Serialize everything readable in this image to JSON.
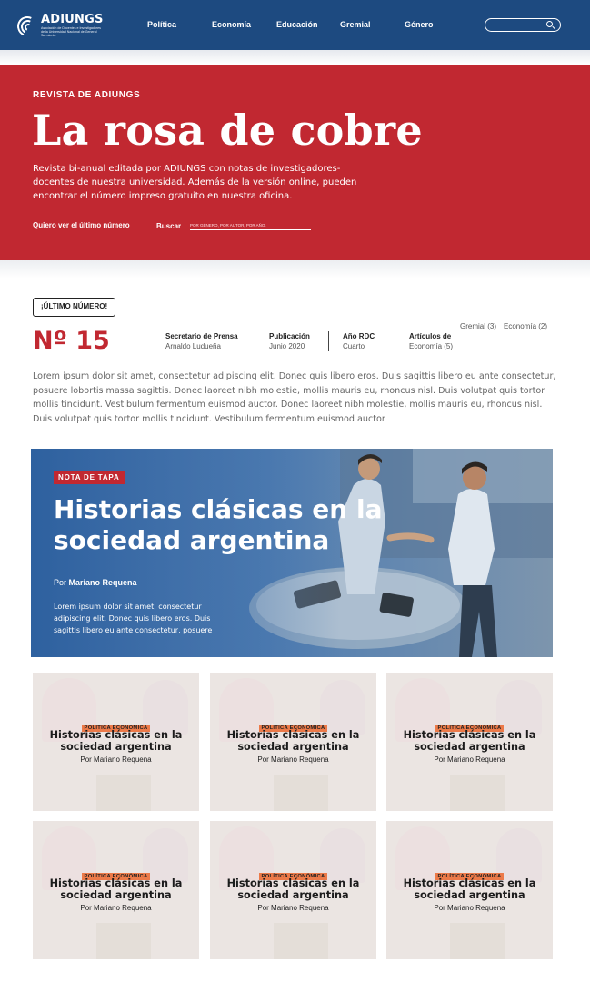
{
  "header": {
    "logo_name": "ADIUNGS",
    "logo_subtitle": "Asociación de Docentes e Investigadores de la Universidad Nacional de General Sarmiento",
    "nav": [
      "Política",
      "Economía",
      "Educación",
      "Gremial",
      "Género"
    ],
    "search_icon": "search-icon",
    "brand_color": "#1d4a80"
  },
  "hero": {
    "kicker": "REVISTA DE ADIUNGS",
    "title": "La rosa de cobre",
    "description": "Revista bi-anual editada por ADIUNGS con notas de investigadores-docentes de nuestra universidad. Además de la versión online, pueden encontrar el número impreso gratuito en nuestra oficina.",
    "latest_link": "Quiero ver el último número",
    "search_label": "Buscar",
    "search_placeholder": "POR GÉNERO, POR AUTOR, POR AÑO.",
    "color": "#c12831"
  },
  "issue": {
    "badge": "¡ÚLTIMO NÚMERO!",
    "number": "Nº 15",
    "meta": [
      {
        "key": "Secretario de Prensa",
        "value": "Arnaldo Ludueña"
      },
      {
        "key": "Publicación",
        "value": "Junio 2020"
      },
      {
        "key": "Año RDC",
        "value": "Cuarto"
      },
      {
        "key": "Artículos de",
        "value": "Economía (5)"
      }
    ],
    "tags": [
      "Gremial (3)",
      "Economía (2)"
    ],
    "body": "Lorem ipsum dolor sit amet, consectetur adipiscing elit. Donec quis libero eros. Duis sagittis libero eu ante consectetur, posuere lobortis massa sagittis. Donec laoreet nibh molestie, mollis mauris eu, rhoncus nisl. Duis volutpat quis tortor mollis tincidunt. Vestibulum fermentum euismod auctor.  Donec laoreet nibh molestie, mollis mauris eu, rhoncus nisl. Duis volutpat quis tortor mollis tincidunt. Vestibulum fermentum euismod auctor"
  },
  "feature": {
    "badge": "NOTA DE TAPA",
    "title": "Historias clásicas en la sociedad argentina",
    "byline_prefix": "Por",
    "author": "Mariano Requena",
    "excerpt": "Lorem ipsum dolor sit amet, consectetur adipiscing elit. Donec quis libero eros. Duis sagittis libero eu ante consectetur, posuere"
  },
  "cards": [
    {
      "badge": "POLÍTICA ECONÓMICA",
      "title": "Historias clásicas en la sociedad argentina",
      "author": "Por Mariano Requena"
    },
    {
      "badge": "POLÍTICA ECONÓMICA",
      "title": "Historias clásicas en la sociedad argentina",
      "author": "Por Mariano Requena"
    },
    {
      "badge": "POLÍTICA ECONÓMICA",
      "title": "Historias clásicas en la sociedad argentina",
      "author": "Por Mariano Requena"
    },
    {
      "badge": "POLÍTICA ECONÓMICA",
      "title": "Historias clásicas en la sociedad argentina",
      "author": "Por Mariano Requena"
    },
    {
      "badge": "POLÍTICA ECONÓMICA",
      "title": "Historias clásicas en la sociedad argentina",
      "author": "Por Mariano Requena"
    },
    {
      "badge": "POLÍTICA ECONÓMICA",
      "title": "Historias clásicas en la sociedad argentina",
      "author": "Por Mariano Requena"
    }
  ]
}
